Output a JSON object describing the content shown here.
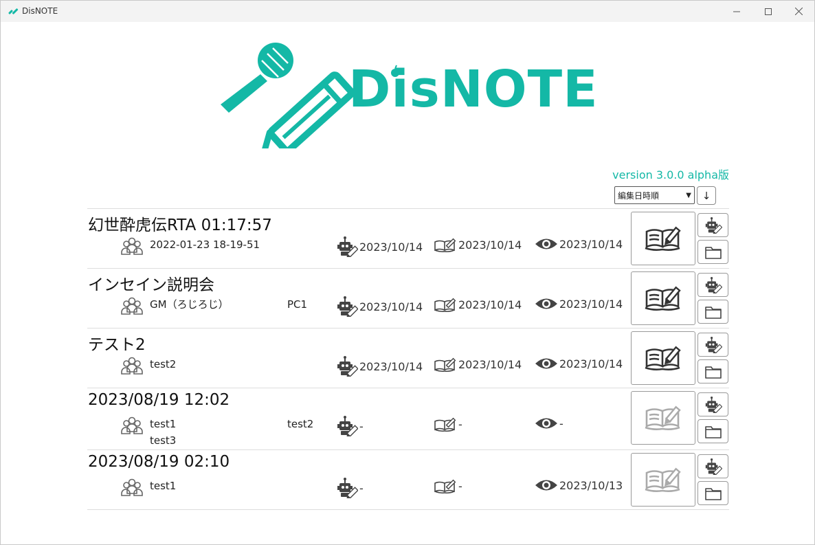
{
  "window": {
    "title": "DisNOTE"
  },
  "logo": {
    "text": "DisNOTE",
    "color": "#14b8a6"
  },
  "version": "version 3.0.0 alpha版",
  "sort": {
    "selected": "編集日時順",
    "direction": "↓"
  },
  "rows": [
    {
      "title": "幻世酔虎伝RTA 01:17:57",
      "members_col1": [
        "2022-01-23 18-19-51"
      ],
      "members_col2": [],
      "ai_date": "2023/10/14",
      "edit_date": "2023/10/14",
      "view_date": "2023/10/14",
      "book_active": true
    },
    {
      "title": "インセイン説明会",
      "members_col1": [
        "GM（ろじろじ）"
      ],
      "members_col2": [
        "PC1"
      ],
      "ai_date": "2023/10/14",
      "edit_date": "2023/10/14",
      "view_date": "2023/10/14",
      "book_active": true
    },
    {
      "title": "テスト2",
      "members_col1": [
        "test2"
      ],
      "members_col2": [],
      "ai_date": "2023/10/14",
      "edit_date": "2023/10/14",
      "view_date": "2023/10/14",
      "book_active": true
    },
    {
      "title": "2023/08/19 12:02",
      "members_col1": [
        "test1",
        "test3"
      ],
      "members_col2": [
        "test2"
      ],
      "ai_date": "-",
      "edit_date": "-",
      "view_date": "-",
      "book_active": false
    },
    {
      "title": "2023/08/19 02:10",
      "members_col1": [
        "test1"
      ],
      "members_col2": [],
      "ai_date": "-",
      "edit_date": "-",
      "view_date": "2023/10/13",
      "book_active": false
    }
  ]
}
